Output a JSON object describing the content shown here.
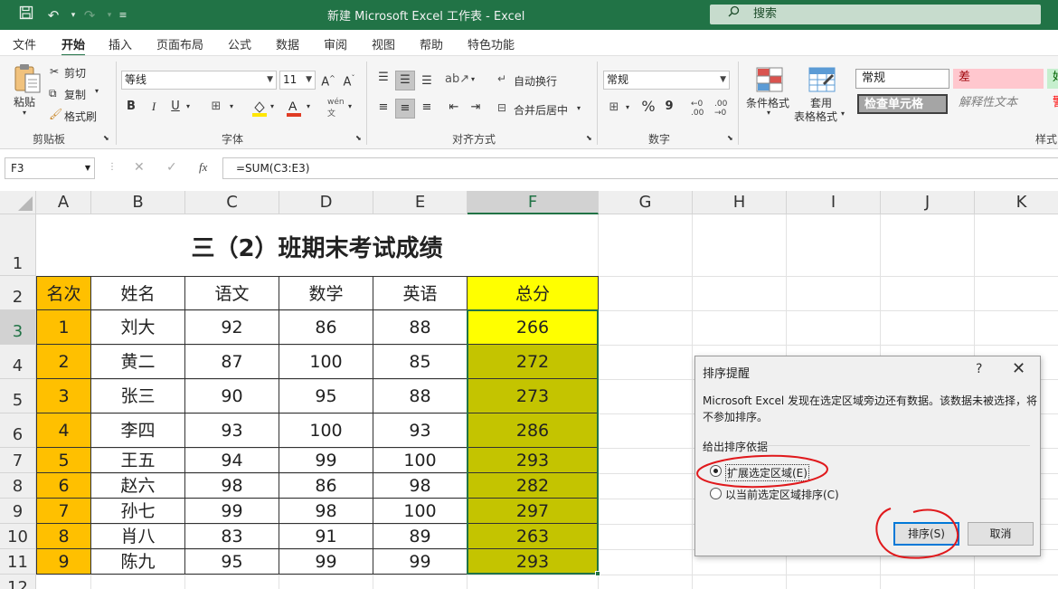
{
  "titlebar": {
    "title": "新建 Microsoft Excel 工作表  -  Excel",
    "search_placeholder": "搜索",
    "icons": [
      "save-icon",
      "undo-icon",
      "redo-icon",
      "customize-qat-icon"
    ]
  },
  "menu": {
    "items": [
      "文件",
      "开始",
      "插入",
      "页面布局",
      "公式",
      "数据",
      "审阅",
      "视图",
      "帮助",
      "特色功能"
    ],
    "active": "开始"
  },
  "ribbon": {
    "clipboard": {
      "paste": "粘贴",
      "cut": "剪切",
      "copy": "复制",
      "format_painter": "格式刷",
      "group": "剪贴板"
    },
    "font": {
      "name": "等线",
      "size": "11",
      "bold": "B",
      "italic": "I",
      "underline": "U",
      "group": "字体",
      "font_color": "#e03b24",
      "fill_color": "#ffe600"
    },
    "alignment": {
      "wrap": "自动换行",
      "merge": "合并后居中",
      "group": "对齐方式"
    },
    "number": {
      "format": "常规",
      "group": "数字",
      "percent": "%",
      "comma": "9"
    },
    "styles": {
      "conditional": "条件格式",
      "table_line1": "套用",
      "table_line2": "表格格式",
      "normal": "常规",
      "bad": "差",
      "check_cell": "检查单元格",
      "explanatory": "解释性文本",
      "good": "好",
      "warn": "警",
      "group": "样式"
    }
  },
  "formula_bar": {
    "name_box": "F3",
    "fx": "fx",
    "formula": "=SUM(C3:E3)"
  },
  "sheet": {
    "columns": [
      "A",
      "B",
      "C",
      "D",
      "E",
      "F",
      "G",
      "H",
      "I",
      "J",
      "K"
    ],
    "rows": [
      "1",
      "2",
      "3",
      "4",
      "5",
      "6",
      "7",
      "8",
      "9",
      "10",
      "11",
      "12"
    ],
    "selected_column": "F",
    "title": "三（2）班期末考试成绩",
    "headers": [
      "名次",
      "姓名",
      "语文",
      "数学",
      "英语",
      "总分"
    ],
    "data": [
      [
        "1",
        "刘大",
        "92",
        "86",
        "88",
        "266"
      ],
      [
        "2",
        "黄二",
        "87",
        "100",
        "85",
        "272"
      ],
      [
        "3",
        "张三",
        "90",
        "95",
        "88",
        "273"
      ],
      [
        "4",
        "李四",
        "93",
        "100",
        "93",
        "286"
      ],
      [
        "5",
        "王五",
        "94",
        "99",
        "100",
        "293"
      ],
      [
        "6",
        "赵六",
        "98",
        "86",
        "98",
        "282"
      ],
      [
        "7",
        "孙七",
        "99",
        "98",
        "100",
        "297"
      ],
      [
        "8",
        "肖八",
        "83",
        "91",
        "89",
        "263"
      ],
      [
        "9",
        "陈九",
        "95",
        "99",
        "99",
        "293"
      ]
    ],
    "colors": {
      "rank_fill": "#ffc000",
      "total_header_fill": "#ffff00",
      "total_fill": "#c4c400",
      "selection": "#217346"
    }
  },
  "dialog": {
    "title": "排序提醒",
    "help": "?",
    "close": "✕",
    "message": "Microsoft Excel 发现在选定区域旁边还有数据。该数据未被选择，将不参加排序。",
    "group_label": "给出排序依据",
    "option1": "扩展选定区域(E)",
    "option2": "以当前选定区域排序(C)",
    "ok": "排序(S)",
    "cancel": "取消",
    "annotation_color": "#e0191c"
  }
}
